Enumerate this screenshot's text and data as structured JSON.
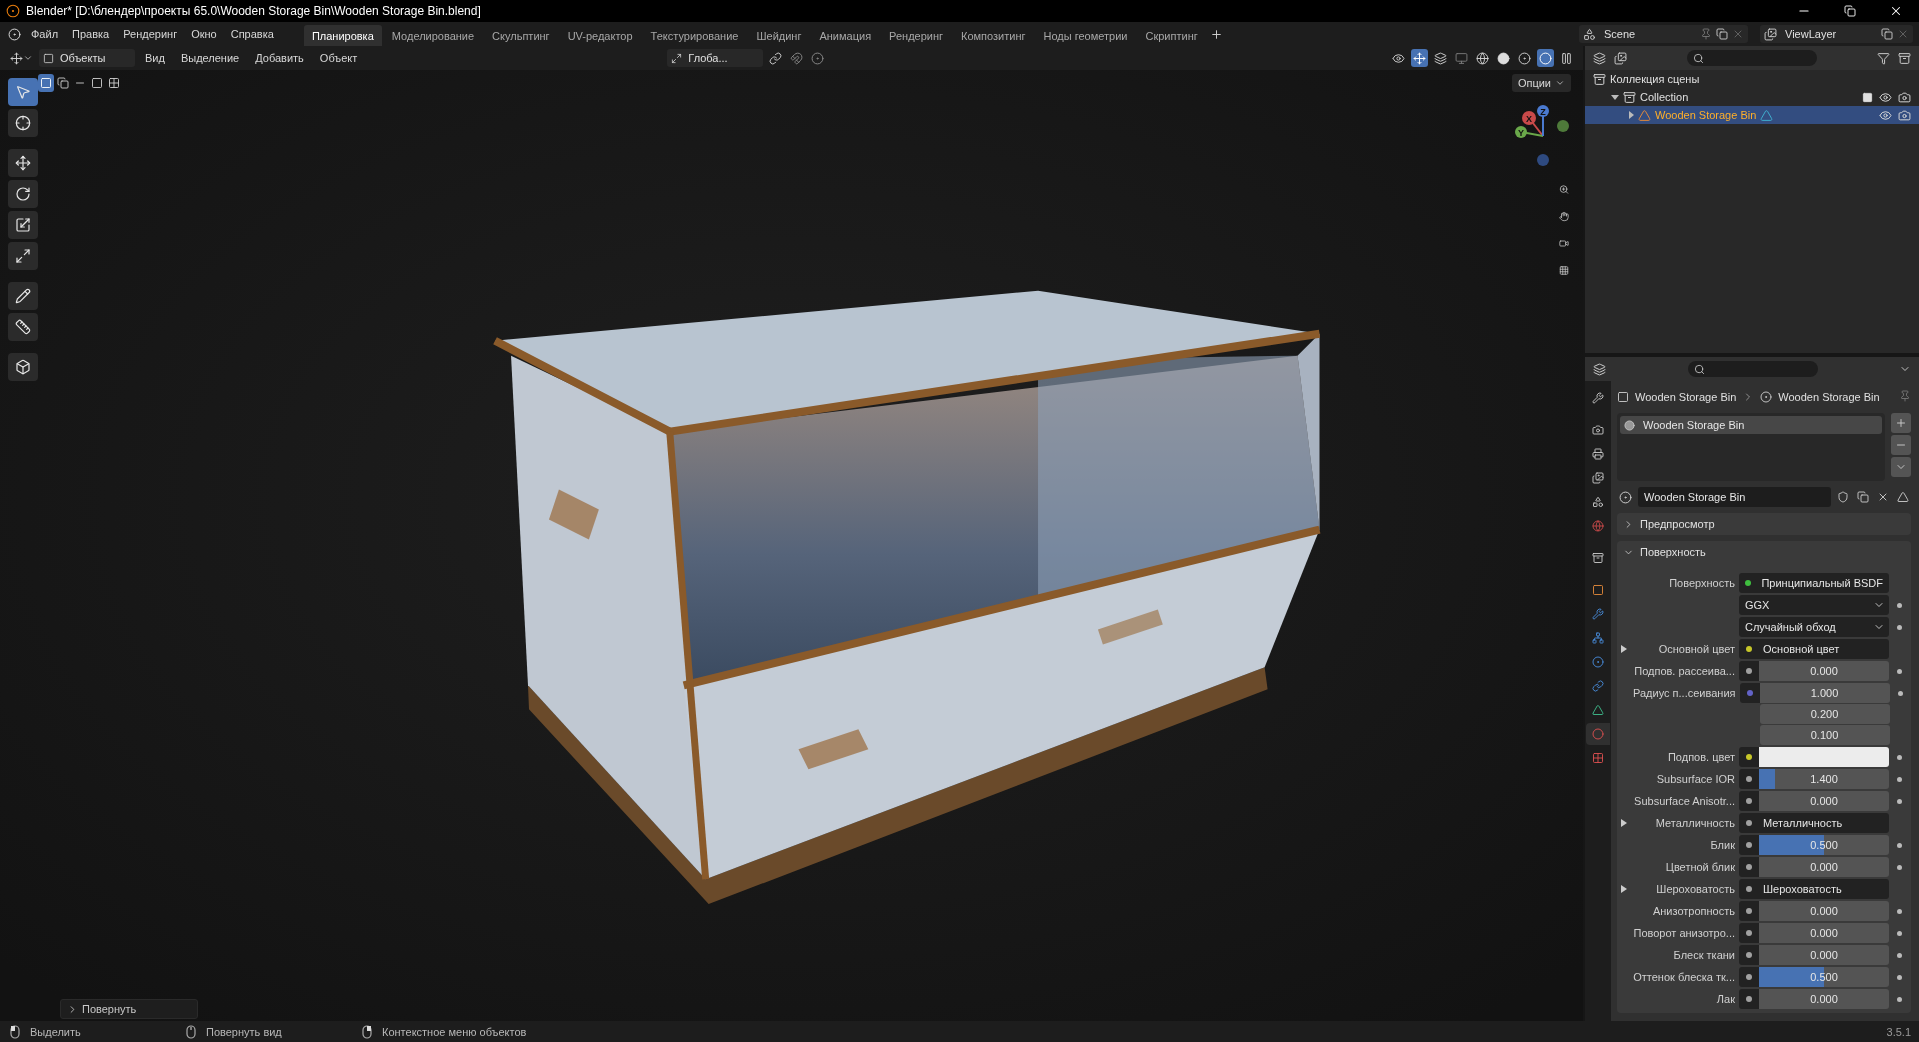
{
  "window": {
    "title": "Blender* [D:\\блендер\\проекты 65.0\\Wooden Storage Bin\\Wooden Storage Bin.blend]"
  },
  "menu": [
    "Файл",
    "Правка",
    "Рендеринг",
    "Окно",
    "Справка"
  ],
  "workspaces": [
    {
      "label": "Планировка",
      "selected": true
    },
    {
      "label": "Моделирование",
      "selected": false
    },
    {
      "label": "Скульптинг",
      "selected": false
    },
    {
      "label": "UV-редактор",
      "selected": false
    },
    {
      "label": "Текстурирование",
      "selected": false
    },
    {
      "label": "Шейдинг",
      "selected": false
    },
    {
      "label": "Анимация",
      "selected": false
    },
    {
      "label": "Рендеринг",
      "selected": false
    },
    {
      "label": "Композитинг",
      "selected": false
    },
    {
      "label": "Ноды геометрии",
      "selected": false
    },
    {
      "label": "Скриптинг",
      "selected": false
    }
  ],
  "scene": "Scene",
  "view_layer": "ViewLayer",
  "viewport": {
    "mode": "Объекты",
    "menus": [
      "Вид",
      "Выделение",
      "Добавить",
      "Объект"
    ],
    "orientation": "Глоба...",
    "options": "Опции",
    "tools": [
      {
        "kind": "select",
        "selected": true
      },
      {
        "kind": "cursor",
        "selected": false
      },
      {
        "kind": "move",
        "selected": false
      },
      {
        "kind": "rotate",
        "selected": false
      },
      {
        "kind": "scale",
        "selected": false
      },
      {
        "kind": "transform",
        "selected": false
      },
      {
        "kind": "annotate",
        "selected": false
      },
      {
        "kind": "measure",
        "selected": false
      },
      {
        "kind": "add_cube",
        "selected": false
      }
    ],
    "gizmo_axes": [
      "X",
      "Y",
      "Z"
    ],
    "last_operator": "Повернуть"
  },
  "outliner": {
    "tree": [
      {
        "label": "Коллекция сцены",
        "kind": "scene_collection",
        "selected": false,
        "children": [
          {
            "label": "Collection",
            "kind": "collection",
            "expanded": true,
            "selected": false,
            "children": [
              {
                "label": "Wooden Storage Bin",
                "kind": "object",
                "expanded": false,
                "selected": true
              }
            ]
          }
        ]
      }
    ]
  },
  "properties": {
    "tabs": [
      {
        "kind": "tool",
        "selected": false
      },
      {
        "kind": "render",
        "selected": false
      },
      {
        "kind": "output",
        "selected": false
      },
      {
        "kind": "view_layer",
        "selected": false
      },
      {
        "kind": "scene",
        "selected": false
      },
      {
        "kind": "world",
        "selected": false
      },
      {
        "kind": "collection",
        "selected": false
      },
      {
        "kind": "object",
        "selected": false
      },
      {
        "kind": "modifiers",
        "selected": false
      },
      {
        "kind": "particles",
        "selected": false
      },
      {
        "kind": "physics",
        "selected": false
      },
      {
        "kind": "constraints",
        "selected": false
      },
      {
        "kind": "data",
        "selected": false
      },
      {
        "kind": "material",
        "selected": true
      },
      {
        "kind": "texture",
        "selected": false
      }
    ],
    "breadcrumb": [
      "Wooden Storage Bin",
      "Wooden Storage Bin"
    ],
    "material_slots": [
      {
        "label": "Wooden Storage Bin",
        "selected": true
      }
    ],
    "material": "Wooden Storage Bin",
    "panels": [
      {
        "title": "Предпросмотр",
        "expanded": false
      },
      {
        "title": "Поверхность",
        "expanded": true,
        "rows": [
          {
            "kind": "link",
            "label": "Поверхность",
            "color": "#3fbf3f",
            "value": "Принципиальный BSDF",
            "expandable": false
          },
          {
            "kind": "dropdown",
            "value": "GGX",
            "expandable": false
          },
          {
            "kind": "dropdown",
            "value": "Случайный обход",
            "expandable": false
          },
          {
            "kind": "link",
            "label": "Основной цвет",
            "color": "#c7c729",
            "value": "Основной цвет",
            "expandable": true
          },
          {
            "kind": "slider",
            "label": "Подпов. рассеива...",
            "color": "#a1a1a1",
            "value": "0.000",
            "level": 0,
            "expandable": false
          },
          {
            "kind": "vector",
            "label": "Радиус п...сеивания",
            "color": "#6363c7",
            "values": [
              "1.000",
              "0.200",
              "0.100"
            ],
            "expandable": false
          },
          {
            "kind": "color",
            "label": "Подпов. цвет",
            "color": "#c7c729",
            "swatch": {
              "color": "#ececec"
            },
            "expandable": false
          },
          {
            "kind": "slider",
            "label": "Subsurface IOR",
            "color": "#a1a1a1",
            "value": "1.400",
            "level": 0.12,
            "expandable": false
          },
          {
            "kind": "slider",
            "label": "Subsurface Anisotr...",
            "color": "#a1a1a1",
            "value": "0.000",
            "level": 0,
            "expandable": false
          },
          {
            "kind": "link",
            "label": "Металличность",
            "color": "#a1a1a1",
            "value": "Металличность",
            "expandable": true
          },
          {
            "kind": "slider",
            "label": "Блик",
            "color": "#a1a1a1",
            "value": "0.500",
            "level": 0.5,
            "expandable": false
          },
          {
            "kind": "slider",
            "label": "Цветной блик",
            "color": "#a1a1a1",
            "value": "0.000",
            "level": 0,
            "expandable": false
          },
          {
            "kind": "link",
            "label": "Шероховатость",
            "color": "#a1a1a1",
            "value": "Шероховатость",
            "expandable": true
          },
          {
            "kind": "slider",
            "label": "Анизотропность",
            "color": "#a1a1a1",
            "value": "0.000",
            "level": 0,
            "expandable": false
          },
          {
            "kind": "slider",
            "label": "Поворот анизотро...",
            "color": "#a1a1a1",
            "value": "0.000",
            "level": 0,
            "expandable": false
          },
          {
            "kind": "slider",
            "label": "Блеск ткани",
            "color": "#a1a1a1",
            "value": "0.000",
            "level": 0,
            "expandable": false
          },
          {
            "kind": "slider",
            "label": "Оттенок блеска тк...",
            "color": "#a1a1a1",
            "value": "0.500",
            "level": 0.5,
            "expandable": false
          },
          {
            "kind": "slider",
            "label": "Лак",
            "color": "#a1a1a1",
            "value": "0.000",
            "level": 0,
            "expandable": false
          }
        ]
      }
    ]
  },
  "status_bar": {
    "hints": [
      {
        "kind": "left_click",
        "label": "Выделить"
      },
      {
        "kind": "middle_click",
        "label": "Повернуть вид"
      },
      {
        "kind": "right_click",
        "label": "Контекстное меню объектов"
      }
    ],
    "version": "3.5.1"
  }
}
